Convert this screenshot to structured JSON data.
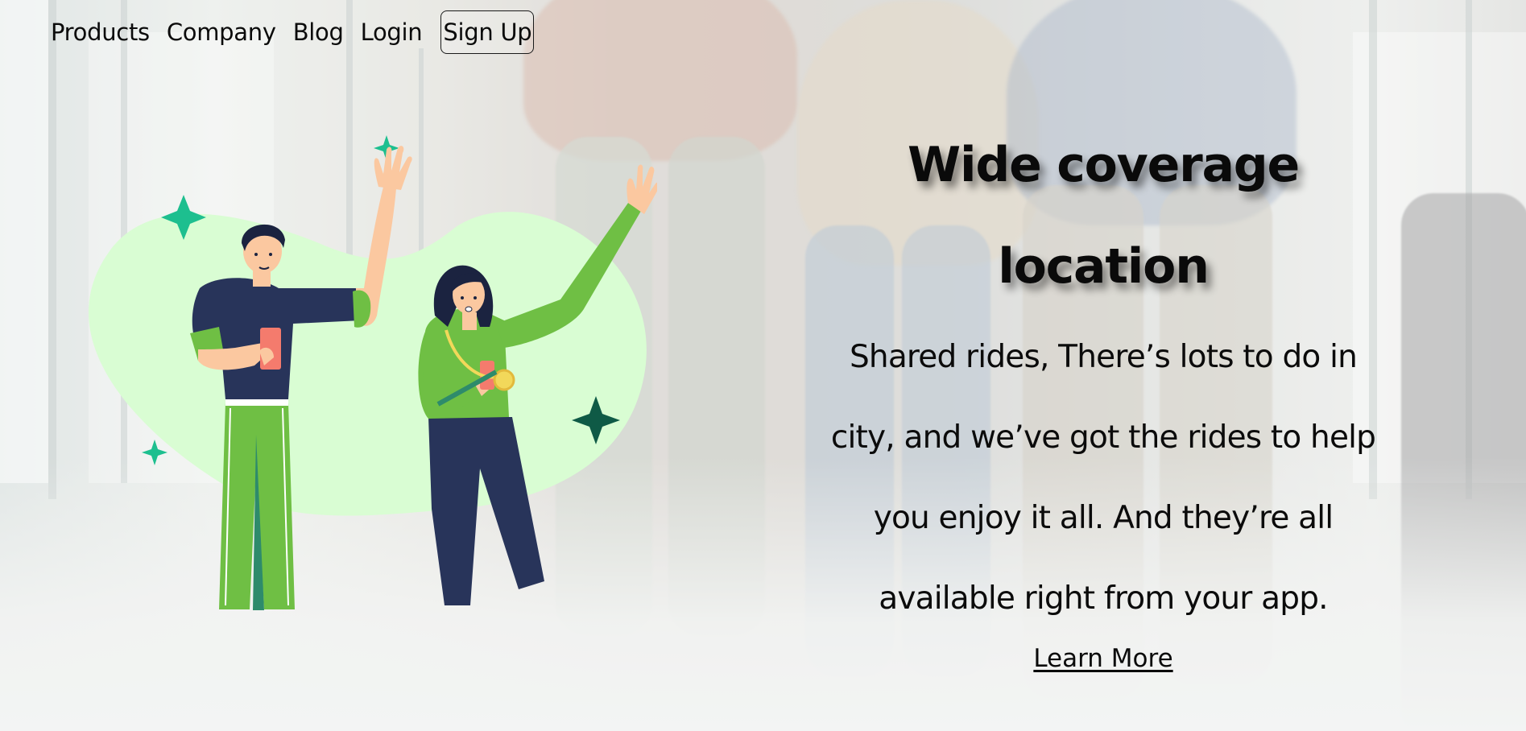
{
  "nav": {
    "items": [
      {
        "label": "Products"
      },
      {
        "label": "Company"
      },
      {
        "label": "Blog"
      },
      {
        "label": "Login"
      }
    ],
    "signup_label": "Sign Up"
  },
  "hero": {
    "title_line1": "Wide coverage",
    "title_line2": "location",
    "description": "Shared rides, There’s lots to do in city, and we’ve got the rides to help you enjoy it all. And they’re all available right from your app.",
    "cta_label": "Learn More"
  },
  "colors": {
    "blob": "#d9fdd3",
    "shirt_green": "#6fbf44",
    "navy": "#28345a",
    "sparkle_teal": "#1dbf8f",
    "sparkle_dark": "#0f5a46",
    "phone": "#f47b6d",
    "skin": "#fbc8a0"
  },
  "icons": [
    "sparkle-icon"
  ]
}
